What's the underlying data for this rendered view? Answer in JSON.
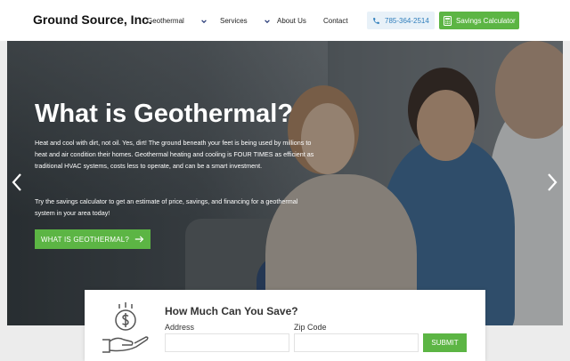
{
  "header": {
    "brand": "Ground Source, Inc.",
    "nav": [
      {
        "label": "Geothermal",
        "has_dropdown": true
      },
      {
        "label": "Services",
        "has_dropdown": true
      },
      {
        "label": "About Us",
        "has_dropdown": false
      },
      {
        "label": "Contact",
        "has_dropdown": false
      }
    ],
    "phone": "785-364-2514",
    "calculator_label": "Savings Calculator"
  },
  "hero": {
    "title": "What is Geothermal?",
    "paragraph1": "Heat and cool with dirt, not oil. Yes, dirt! The ground beneath your feet is being used by millions to heat and air condition their homes. Geothermal heating and cooling is FOUR TIMES as efficient as traditional HVAC systems, costs less to operate, and can be a smart investment.",
    "paragraph2": "Try the savings calculator to get an estimate of price, savings, and financing for a geothermal system in your area today!",
    "cta_label": "WHAT IS GEOTHERMAL?"
  },
  "savings_form": {
    "title": "How Much Can You Save?",
    "address_label": "Address",
    "address_value": "",
    "zip_label": "Zip Code",
    "zip_value": "",
    "submit_label": "SUBMIT"
  },
  "colors": {
    "accent_green": "#5cb544",
    "phone_blue": "#2e7dbb"
  },
  "icons": [
    "chevron-down-icon",
    "phone-icon",
    "calculator-icon",
    "arrow-right-icon",
    "chevron-left-icon",
    "chevron-right-icon",
    "money-hand-icon"
  ]
}
